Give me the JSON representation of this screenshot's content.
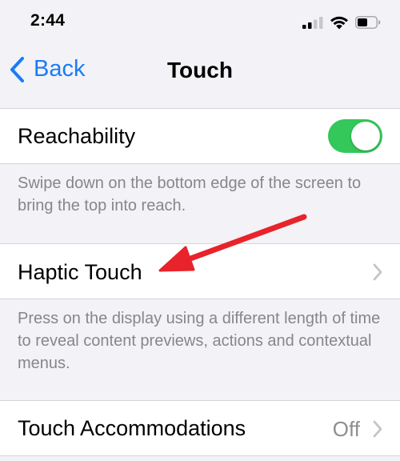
{
  "status_bar": {
    "time": "2:44",
    "icons": [
      "cellular-signal-icon",
      "wifi-icon",
      "battery-icon"
    ]
  },
  "nav": {
    "back_label": "Back",
    "title": "Touch"
  },
  "reachability": {
    "label": "Reachability",
    "enabled": true,
    "footer": "Swipe down on the bottom edge of the screen to bring the top into reach."
  },
  "haptic_touch": {
    "label": "Haptic Touch",
    "footer": "Press on the display using a different length of time to reveal content previews, actions and contextual menus."
  },
  "touch_accommodations": {
    "label": "Touch Accommodations",
    "value": "Off"
  },
  "colors": {
    "accent": "#1a7cf5",
    "toggle_on": "#34c759",
    "annotation_arrow": "#e8232b",
    "background": "#f2f2f7",
    "secondary_text": "#86868b"
  }
}
